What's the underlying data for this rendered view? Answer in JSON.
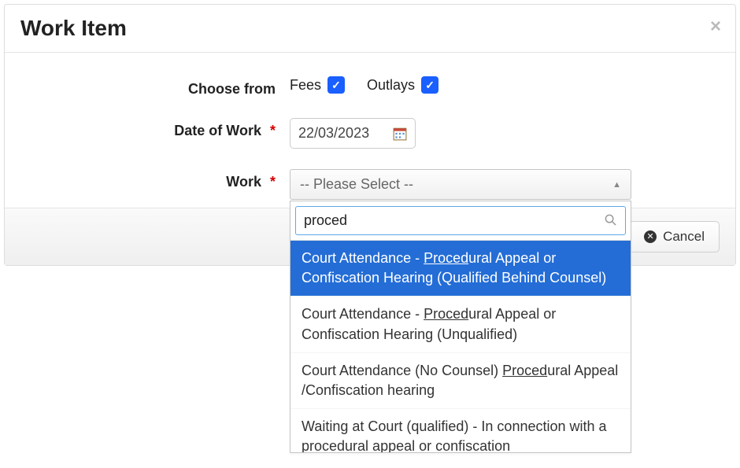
{
  "modal": {
    "title": "Work Item",
    "close_label": "×"
  },
  "form": {
    "choose_from": {
      "label": "Choose from",
      "fees_label": "Fees",
      "fees_checked": true,
      "outlays_label": "Outlays",
      "outlays_checked": true
    },
    "date_of_work": {
      "label": "Date of Work",
      "required_mark": "*",
      "value": "22/03/2023"
    },
    "work": {
      "label": "Work",
      "required_mark": "*",
      "placeholder": "-- Please Select --",
      "search_value": "proced",
      "options": [
        {
          "prefix": "Court Attendance - ",
          "hl": "Proced",
          "suffix": "ural Appeal or Confiscation Hearing (Qualified Behind Counsel)",
          "selected": true
        },
        {
          "prefix": "Court Attendance - ",
          "hl": "Proced",
          "suffix": "ural Appeal or Confiscation Hearing (Unqualified)",
          "selected": false
        },
        {
          "prefix": "Court Attendance (No Counsel) ",
          "hl": "Proced",
          "suffix": "ural Appeal /Confiscation hearing",
          "selected": false
        },
        {
          "prefix": "Waiting at Court (qualified) - In connection with a procedural appeal or confiscation",
          "hl": "",
          "suffix": "",
          "selected": false
        }
      ]
    }
  },
  "footer": {
    "cancel_label": "Cancel"
  }
}
